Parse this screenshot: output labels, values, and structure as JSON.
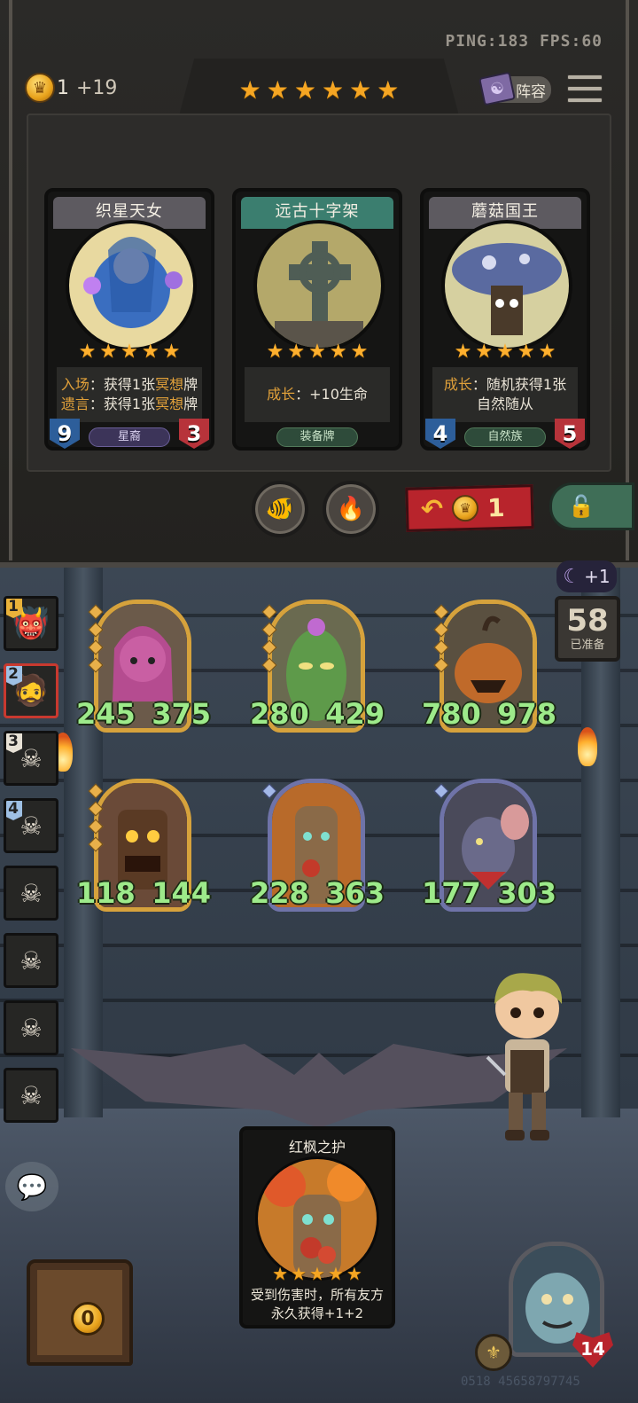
{
  "hud": {
    "ping_fps": "PING:183  FPS:60",
    "gold": "1",
    "gold_income": "+19",
    "tavern_stars": 6,
    "lineup_label": "阵容",
    "star_glyph": "★"
  },
  "shop": {
    "cards": [
      {
        "name": "织星天女",
        "stars": 5,
        "desc_lines": [
          {
            "kw": "入场",
            "text": "：获得1张",
            "kw2": "冥想",
            "end": "牌"
          },
          {
            "kw": "遗言",
            "text": "：获得1张",
            "kw2": "冥想",
            "end": "牌"
          }
        ],
        "attack": "9",
        "health": "3",
        "tribe": "星裔",
        "style": "purple"
      },
      {
        "name": "远古十字架",
        "stars": 5,
        "desc_lines": [
          {
            "kw": "成长",
            "text": "：+10生命",
            "kw2": "",
            "end": ""
          }
        ],
        "attack": "",
        "health": "",
        "tribe": "装备牌",
        "style": "teal"
      },
      {
        "name": "蘑菇国王",
        "stars": 5,
        "desc_lines": [
          {
            "kw": "成长",
            "text": "：随机获得1张",
            "kw2": "",
            "end": ""
          },
          {
            "kw": "",
            "text": "自然随从",
            "kw2": "",
            "end": ""
          }
        ],
        "attack": "4",
        "health": "5",
        "tribe": "自然族",
        "style": "purple"
      }
    ],
    "refresh_cost": "1",
    "buttons": {
      "fishbowl_icon": "fishbowl-icon",
      "lighter_icon": "lighter-icon"
    }
  },
  "board": {
    "moon_bonus": "+1",
    "timer": "58",
    "timer_label": "已准备",
    "minions": [
      {
        "attack": "245",
        "health": "375",
        "tier": "gold",
        "art": "pink-elf"
      },
      {
        "attack": "280",
        "health": "429",
        "tier": "gold",
        "art": "cactus"
      },
      {
        "attack": "780",
        "health": "978",
        "tier": "gold",
        "art": "pumpkin"
      },
      {
        "attack": "118",
        "health": "144",
        "tier": "gold",
        "art": "tiki"
      },
      {
        "attack": "228",
        "health": "363",
        "tier": "silver",
        "art": "maple-treant"
      },
      {
        "attack": "177",
        "health": "303",
        "tier": "silver",
        "art": "rat"
      }
    ]
  },
  "players": [
    {
      "rank": "1",
      "face": "👹",
      "dead": false,
      "me": false
    },
    {
      "rank": "2",
      "face": "🧔",
      "dead": false,
      "me": true
    },
    {
      "rank": "3",
      "face": "",
      "dead": true,
      "me": false
    },
    {
      "rank": "4",
      "face": "",
      "dead": true,
      "me": false
    },
    {
      "rank": "",
      "face": "",
      "dead": true,
      "me": false
    },
    {
      "rank": "",
      "face": "",
      "dead": true,
      "me": false
    },
    {
      "rank": "",
      "face": "",
      "dead": true,
      "me": false
    },
    {
      "rank": "",
      "face": "",
      "dead": true,
      "me": false
    }
  ],
  "hand": {
    "name": "红枫之护",
    "stars": 5,
    "desc": "受到伤害时，所有友方永久获得+1+2"
  },
  "footer": {
    "chest_count": "0",
    "hero_hp": "14",
    "uid": "0518 45658797745"
  }
}
